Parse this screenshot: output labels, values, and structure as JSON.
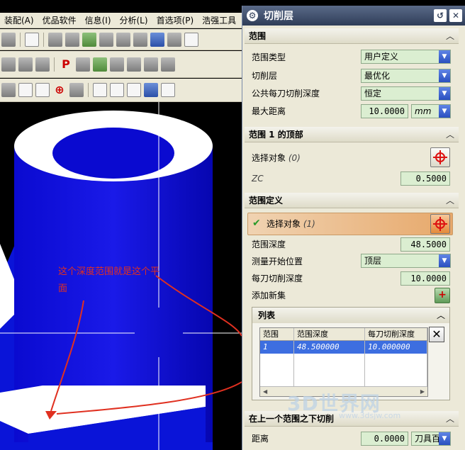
{
  "app": {
    "menus": [
      "装配(A)",
      "优品软件",
      "信息(I)",
      "分析(L)",
      "首选项(P)",
      "浩强工具"
    ]
  },
  "viewport": {
    "annotation": "这个深度范围就是这个平面"
  },
  "dialog": {
    "title": "切削层",
    "sections": {
      "range": {
        "header": "范围",
        "range_type_label": "范围类型",
        "range_type_value": "用户定义",
        "cut_layer_label": "切削层",
        "cut_layer_value": "最优化",
        "common_depth_label": "公共每刀切削深度",
        "common_depth_value": "恒定",
        "max_distance_label": "最大距离",
        "max_distance_value": "10.0000",
        "max_distance_unit": "mm"
      },
      "range1_top": {
        "header": "范围 1 的顶部",
        "select_label": "选择对象",
        "select_count": "(0)",
        "zc_label": "ZC",
        "zc_value": "0.5000"
      },
      "range_def": {
        "header": "范围定义",
        "select_label": "选择对象",
        "select_count": "(1)",
        "depth_label": "范围深度",
        "depth_value": "48.5000",
        "measure_label": "测量开始位置",
        "measure_value": "顶层",
        "per_cut_label": "每刀切削深度",
        "per_cut_value": "10.0000",
        "add_set_label": "添加新集"
      },
      "list": {
        "header": "列表",
        "columns": [
          "范围",
          "范围深度",
          "每刀切削深度"
        ],
        "rows": [
          {
            "range": "1",
            "depth": "48.500000",
            "per_cut": "10.000000"
          }
        ]
      },
      "below": {
        "header": "在上一个范围之下切削",
        "distance_label": "距离",
        "distance_value": "0.0000",
        "distance_unit": "刀具百"
      }
    }
  },
  "watermark": {
    "brand": "3D世界网",
    "url": "www.3dsjw.com"
  },
  "colors": {
    "part": "#0a14d8",
    "annotation": "#e03020",
    "highlight": "#3d6ee0"
  }
}
